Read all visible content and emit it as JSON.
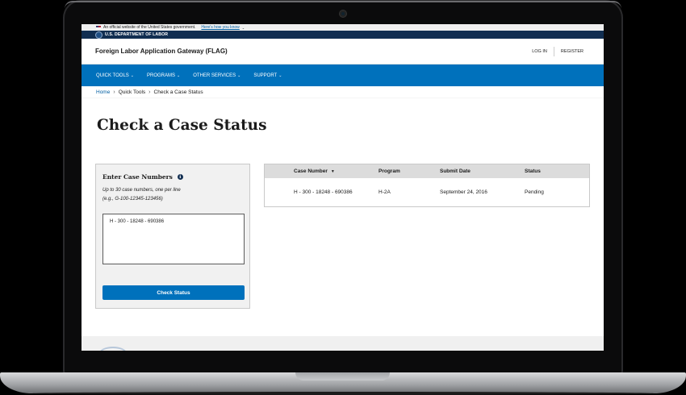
{
  "gov_banner": {
    "text": "An official website of the United States government.",
    "link": "Here's how you know"
  },
  "agency": {
    "name": "U.S. DEPARTMENT OF LABOR"
  },
  "header": {
    "site_title": "Foreign Labor Application Gateway (FLAG)",
    "login": "LOG IN",
    "register": "REGISTER"
  },
  "nav": {
    "items": [
      {
        "label": "QUICK TOOLS"
      },
      {
        "label": "PROGRAMS"
      },
      {
        "label": "OTHER SERVICES"
      },
      {
        "label": "SUPPORT"
      }
    ]
  },
  "breadcrumb": {
    "home": "Home",
    "quick_tools": "Quick Tools",
    "current": "Check a Case Status"
  },
  "page": {
    "title": "Check a Case Status"
  },
  "form": {
    "title": "Enter Case Numbers",
    "hint_line1": "Up to 30 case numbers, one per line",
    "hint_line2": "(e.g., G-100-12345-123456)",
    "textarea_value": "H - 300 - 18248 - 690386",
    "button": "Check Status"
  },
  "results": {
    "columns": [
      "Case Number",
      "Program",
      "Submit Date",
      "Status"
    ],
    "rows": [
      {
        "case_number": "H - 300 - 18248 - 690386",
        "program": "H-2A",
        "submit_date": "September 24, 2016",
        "status": "Pending"
      }
    ]
  },
  "colors": {
    "primary": "#0071bc",
    "navy": "#112e51",
    "header_bg": "#dcdcdc"
  }
}
